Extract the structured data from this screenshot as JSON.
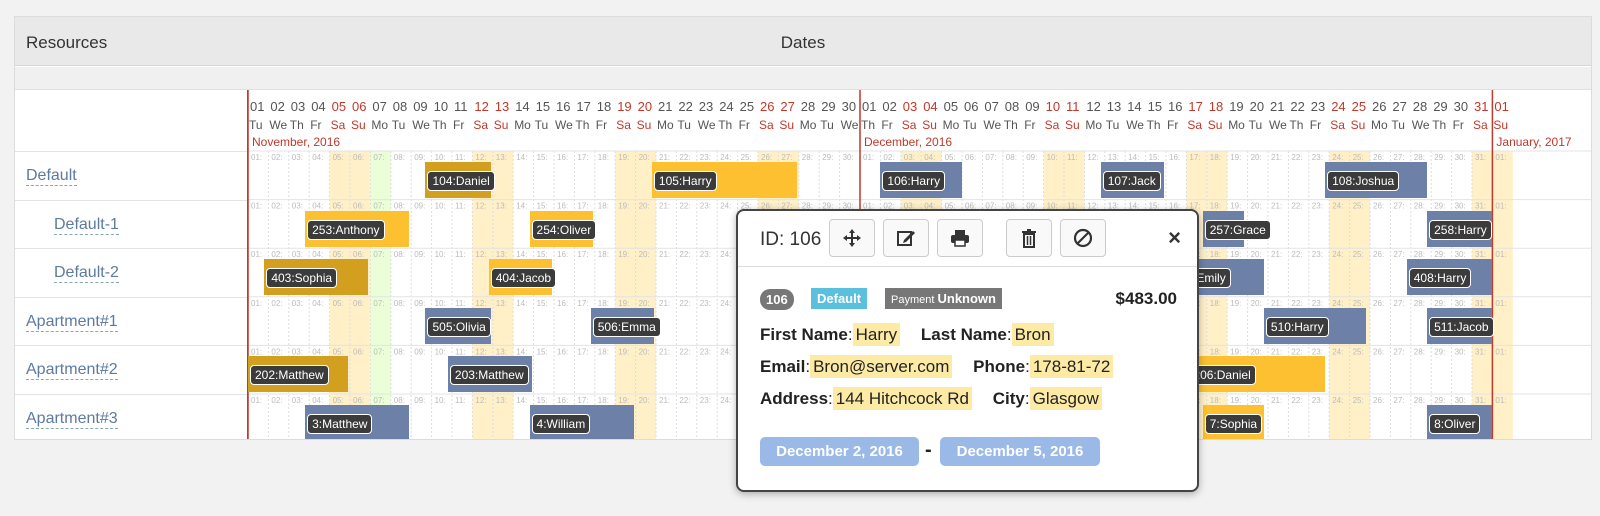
{
  "header": {
    "resources": "Resources",
    "dates": "Dates"
  },
  "resources": [
    {
      "label": "Default",
      "indent": false
    },
    {
      "label": "Default-1",
      "indent": true
    },
    {
      "label": "Default-2",
      "indent": true
    },
    {
      "label": "Apartment#1",
      "indent": false
    },
    {
      "label": "Apartment#2",
      "indent": false
    },
    {
      "label": "Apartment#3",
      "indent": false
    }
  ],
  "months": [
    {
      "name": "November, 2016",
      "start": 0
    },
    {
      "name": "December, 2016",
      "start": 30
    },
    {
      "name": "January, 2017",
      "start": 61
    }
  ],
  "calendar": {
    "first_weekday": 2,
    "days": 62,
    "today_index": 6
  },
  "weekday_names": [
    "Su",
    "Mo",
    "Tu",
    "We",
    "Th",
    "Fr",
    "Sa"
  ],
  "colors": {
    "approved": "#d2a01e",
    "pending": "#fcc030",
    "blue": "#6c80a8",
    "weekend": "#fff0c8",
    "accent": "#c0392b"
  },
  "bookings": [
    {
      "row": 0,
      "start": 8.7,
      "end": 11.9,
      "label": "104:Daniel",
      "color": "approved"
    },
    {
      "row": 0,
      "start": 19.8,
      "end": 26.9,
      "label": "105:Harry",
      "color": "pending"
    },
    {
      "row": 0,
      "start": 31.0,
      "end": 35.0,
      "label": "106:Harry",
      "color": "blue"
    },
    {
      "row": 0,
      "start": 41.8,
      "end": 44.9,
      "label": "107:Jack",
      "color": "blue"
    },
    {
      "row": 0,
      "start": 52.8,
      "end": 57.8,
      "label": "108:Joshua",
      "color": "blue"
    },
    {
      "row": 1,
      "start": 2.8,
      "end": 7.9,
      "label": "253:Anthony",
      "color": "pending"
    },
    {
      "row": 1,
      "start": 13.8,
      "end": 16.9,
      "label": "254:Oliver",
      "color": "pending"
    },
    {
      "row": 1,
      "start": 46.8,
      "end": 48.8,
      "label": "257:Grace",
      "color": "blue"
    },
    {
      "row": 1,
      "start": 57.8,
      "end": 61.0,
      "label": "258:Harry",
      "color": "blue"
    },
    {
      "row": 2,
      "start": 0.8,
      "end": 5.9,
      "label": "403:Sophia",
      "color": "approved"
    },
    {
      "row": 2,
      "start": 11.8,
      "end": 14.9,
      "label": "404:Jacob",
      "color": "pending"
    },
    {
      "row": 2,
      "start": 45.0,
      "end": 49.8,
      "label": "407:Emily",
      "color": "blue"
    },
    {
      "row": 2,
      "start": 56.8,
      "end": 61.0,
      "label": "408:Harry",
      "color": "blue"
    },
    {
      "row": 3,
      "start": 8.7,
      "end": 11.9,
      "label": "505:Olivia",
      "color": "blue"
    },
    {
      "row": 3,
      "start": 16.8,
      "end": 19.9,
      "label": "506:Emma",
      "color": "blue"
    },
    {
      "row": 3,
      "start": 49.8,
      "end": 54.8,
      "label": "510:Harry",
      "color": "blue"
    },
    {
      "row": 3,
      "start": 57.8,
      "end": 61.0,
      "label": "511:Jacob",
      "color": "blue"
    },
    {
      "row": 4,
      "start": 0.0,
      "end": 4.9,
      "label": "202:Matthew",
      "color": "approved"
    },
    {
      "row": 4,
      "start": 9.8,
      "end": 13.9,
      "label": "203:Matthew",
      "color": "blue"
    },
    {
      "row": 4,
      "start": 46.0,
      "end": 52.8,
      "label": "206:Daniel",
      "color": "pending"
    },
    {
      "row": 5,
      "start": 2.8,
      "end": 7.9,
      "label": "3:Matthew",
      "color": "blue"
    },
    {
      "row": 5,
      "start": 13.8,
      "end": 18.9,
      "label": "4:William",
      "color": "blue"
    },
    {
      "row": 5,
      "start": 46.8,
      "end": 49.8,
      "label": "7:Sophia",
      "color": "pending"
    },
    {
      "row": 5,
      "start": 57.8,
      "end": 61.0,
      "label": "8:Oliver",
      "color": "blue"
    }
  ],
  "popup": {
    "title": "ID: 106",
    "id_badge": "106",
    "status_badge": "Default",
    "payment_prefix": "Payment",
    "payment_status": "Unknown",
    "price": "$483.00",
    "first_name_label": "First Name",
    "first_name": "Harry",
    "last_name_label": "Last Name",
    "last_name": "Bron",
    "email_label": "Email",
    "email": "Bron@server.com",
    "phone_label": "Phone",
    "phone": "178-81-72",
    "address_label": "Address",
    "address": "144 Hitchcock Rd",
    "city_label": "City",
    "city": "Glasgow",
    "date_from": "December 2, 2016",
    "date_sep": "-",
    "date_to": "December 5, 2016",
    "close_glyph": "×"
  }
}
